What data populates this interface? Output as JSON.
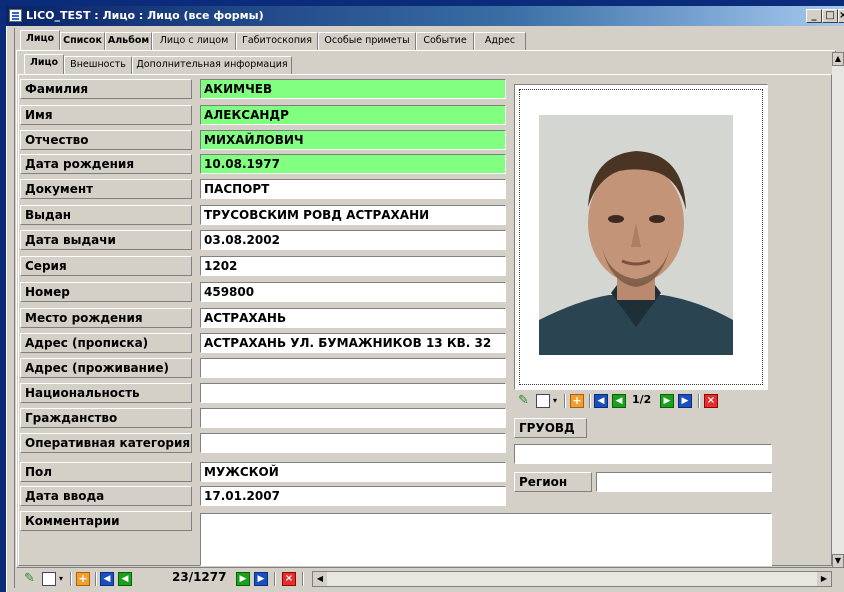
{
  "window": {
    "title": "LICO_TEST : Лицо : Лицо (все формы)",
    "buttons": [
      "_",
      "□",
      "×"
    ]
  },
  "main_tabs": [
    "Лицо",
    "Список",
    "Альбом",
    "Лицо с лицом",
    "Габитоскопия",
    "Особые приметы",
    "Событие",
    "Адрес"
  ],
  "sub_tabs": [
    "Лицо",
    "Внешность",
    "Дополнительная информация"
  ],
  "fields": [
    {
      "label": "Фамилия",
      "value": "АКИМЧЕВ",
      "highlight": true
    },
    {
      "label": "Имя",
      "value": "АЛЕКСАНДР",
      "highlight": true
    },
    {
      "label": "Отчество",
      "value": "МИХАЙЛОВИЧ",
      "highlight": true
    },
    {
      "label": "Дата рождения",
      "value": "10.08.1977",
      "highlight": true
    },
    {
      "label": "Документ",
      "value": "ПАСПОРТ",
      "highlight": false
    },
    {
      "label": "Выдан",
      "value": "ТРУСОВСКИМ РОВД АСТРАХАНИ",
      "highlight": false
    },
    {
      "label": "Дата выдачи",
      "value": "03.08.2002",
      "highlight": false
    },
    {
      "label": "Серия",
      "value": "1202",
      "highlight": false
    },
    {
      "label": "Номер",
      "value": "459800",
      "highlight": false
    },
    {
      "label": "Место рождения",
      "value": "АСТРАХАНЬ",
      "highlight": false
    },
    {
      "label": "Адрес (прописка)",
      "value": "АСТРАХАНЬ УЛ. БУМАЖНИКОВ 13 КВ. 32",
      "highlight": false
    },
    {
      "label": "Адрес (проживание)",
      "value": "",
      "highlight": false
    },
    {
      "label": "Национальность",
      "value": "",
      "highlight": false
    },
    {
      "label": "Гражданство",
      "value": "",
      "highlight": false
    },
    {
      "label": "Оперативная категория",
      "value": "",
      "highlight": false
    },
    {
      "label": "Пол",
      "value": "МУЖСКОЙ",
      "highlight": false
    },
    {
      "label": "Дата ввода",
      "value": "17.01.2007",
      "highlight": false
    }
  ],
  "comment": {
    "label": "Комментарии",
    "value": ""
  },
  "photo": {
    "counter": "1/2"
  },
  "groovd": {
    "label": "ГРУОВД",
    "value": ""
  },
  "region": {
    "label": "Регион",
    "value": ""
  },
  "record_nav": {
    "counter": "23/1277"
  },
  "colors": {
    "highlight": "#80ff80",
    "title_bar": "#0a246a",
    "window_bg": "#d4d0c8",
    "desktop": "#0a2c7a"
  }
}
